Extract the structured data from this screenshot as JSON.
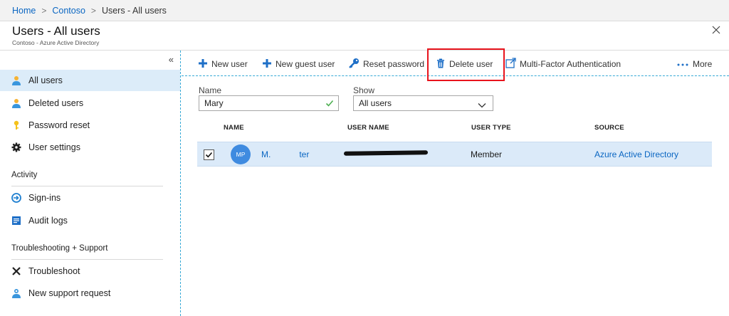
{
  "breadcrumb": [
    "Home",
    "Contoso",
    "Users - All users"
  ],
  "header": {
    "title": "Users - All users",
    "subtitle": "Contoso - Azure Active Directory"
  },
  "sidebar": {
    "collapse_glyph": "«",
    "items": [
      {
        "label": "All users",
        "icon": "user-icon",
        "active": true
      },
      {
        "label": "Deleted users",
        "icon": "user-icon"
      },
      {
        "label": "Password reset",
        "icon": "key-icon"
      },
      {
        "label": "User settings",
        "icon": "gear-icon"
      }
    ],
    "sections": [
      {
        "label": "Activity",
        "items": [
          {
            "label": "Sign-ins",
            "icon": "signin-icon"
          },
          {
            "label": "Audit logs",
            "icon": "audit-log-icon"
          }
        ]
      },
      {
        "label": "Troubleshooting + Support",
        "items": [
          {
            "label": "Troubleshoot",
            "icon": "tools-icon"
          },
          {
            "label": "New support request",
            "icon": "support-icon"
          }
        ]
      }
    ]
  },
  "toolbar": {
    "new_user": "New user",
    "new_guest_user": "New guest user",
    "reset_password": "Reset password",
    "delete_user": "Delete user",
    "mfa": "Multi-Factor Authentication",
    "more": "More"
  },
  "filters": {
    "name_label": "Name",
    "name_value": "Mary",
    "show_label": "Show",
    "show_value": "All users"
  },
  "table": {
    "columns": [
      "NAME",
      "USER NAME",
      "USER TYPE",
      "SOURCE"
    ],
    "rows": [
      {
        "initials": "MP",
        "name_visible_start": "M.",
        "name_visible_end": "ter",
        "user_type": "Member",
        "source": "Azure Active Directory",
        "selected": true
      }
    ]
  },
  "colors": {
    "accent": "#0a66c2",
    "highlight": "#e8141d",
    "selected_row": "#dbeaf9",
    "avatar": "#3f8be0"
  }
}
